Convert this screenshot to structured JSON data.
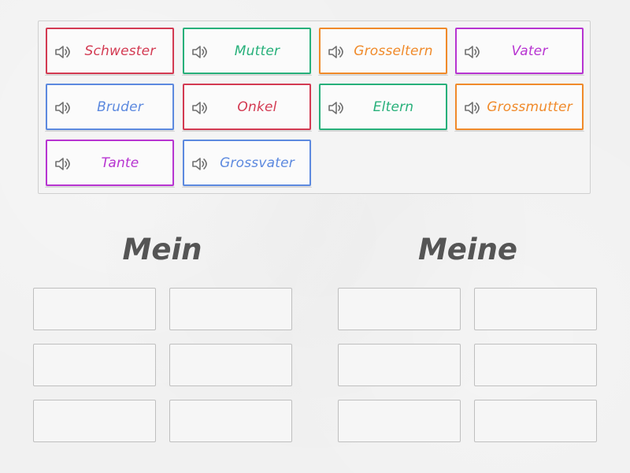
{
  "cards": [
    {
      "label": "Schwester",
      "color": "#d33a52",
      "icon": "speaker-icon"
    },
    {
      "label": "Mutter",
      "color": "#27b07a",
      "icon": "speaker-icon"
    },
    {
      "label": "Grosseltern",
      "color": "#f08a2a",
      "icon": "speaker-icon"
    },
    {
      "label": "Vater",
      "color": "#b734d1",
      "icon": "speaker-icon"
    },
    {
      "label": "Bruder",
      "color": "#5c89df",
      "icon": "speaker-icon"
    },
    {
      "label": "Onkel",
      "color": "#d33a52",
      "icon": "speaker-icon"
    },
    {
      "label": "Eltern",
      "color": "#27b07a",
      "icon": "speaker-icon"
    },
    {
      "label": "Grossmutter",
      "color": "#f08a2a",
      "icon": "speaker-icon"
    },
    {
      "label": "Tante",
      "color": "#b734d1",
      "icon": "speaker-icon"
    },
    {
      "label": "Grossvater",
      "color": "#5c89df",
      "icon": "speaker-icon"
    }
  ],
  "groups": [
    {
      "title": "Mein"
    },
    {
      "title": "Meine"
    }
  ],
  "colors": {
    "page_background": "#f1f1f1",
    "title_text": "#555555",
    "slot_border": "#bfbfbf",
    "speaker_icon": "#6f6f6f"
  }
}
